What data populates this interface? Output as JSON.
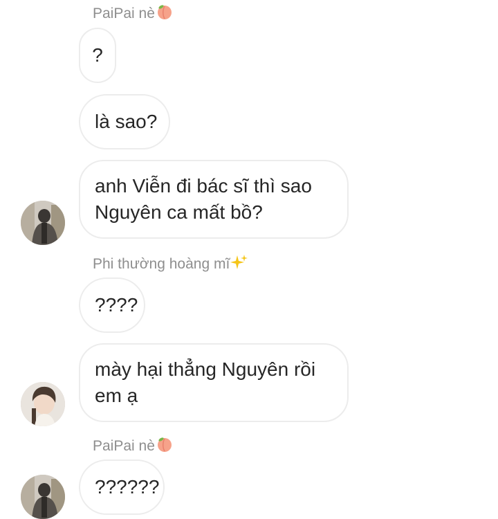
{
  "messages": [
    {
      "sender": "PaiPai nè",
      "sender_emoji": "peach-emoji"
    },
    {
      "text": "?"
    },
    {
      "text": "là sao?"
    },
    {
      "lines": [
        "anh Viễn đi bác sĩ thì sao",
        "Nguyên ca mất bồ?"
      ]
    },
    {
      "sender": "Phi thường hoàng mĩ",
      "sender_emoji": "sparkles-emoji"
    },
    {
      "text": "????"
    },
    {
      "lines": [
        "mày hại thẳng Nguyên rồi",
        "em ạ"
      ]
    },
    {
      "sender": "PaiPai nè",
      "sender_emoji": "peach-emoji"
    },
    {
      "text": "??????"
    }
  ],
  "avatars": [
    "avatar-pai",
    "avatar-phi",
    "avatar-pai"
  ]
}
